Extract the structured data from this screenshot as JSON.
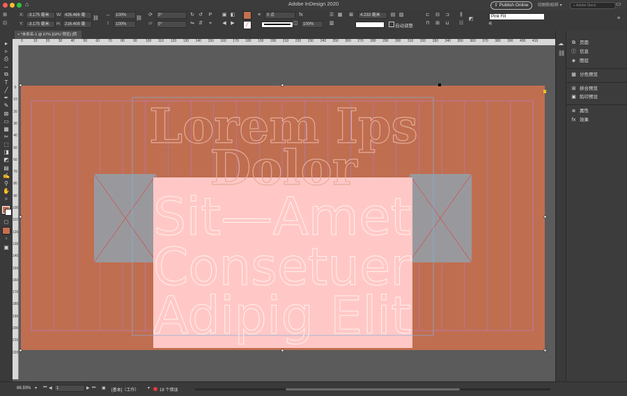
{
  "app": {
    "title": "Adobe InDesign 2020",
    "publish_label": "Publish Online",
    "workspace_label": "印刷和校样",
    "search_placeholder": "Adobe Stock"
  },
  "control": {
    "x_label": "X:",
    "x_value": "-3.175 毫米",
    "y_label": "Y:",
    "y_value": "-3.175 毫米",
    "w_label": "W:",
    "w_value": "426.466 毫",
    "h_label": "H:",
    "h_value": "216.408 毫",
    "scale_x": "100%",
    "scale_y": "100%",
    "rotate": "0°",
    "shear": "0°",
    "stroke_weight": "0 点",
    "opacity": "100%",
    "gap_value": "4.233 毫米",
    "auto_fit": "自动调整",
    "style_value": "Pink Fill",
    "fill_color": "#c5714f"
  },
  "tab": {
    "label": "*未命名-1 @ 67% [GPU 预览] [转换]"
  },
  "ruler": {
    "h": [
      "0",
      "10",
      "20",
      "30",
      "40",
      "50",
      "60",
      "70",
      "80",
      "90",
      "100",
      "110",
      "120",
      "130",
      "140",
      "150",
      "160",
      "170",
      "180",
      "190",
      "200",
      "210",
      "220",
      "230",
      "240",
      "250",
      "260",
      "270",
      "280",
      "290",
      "300",
      "310",
      "320",
      "330",
      "340",
      "350",
      "360",
      "370",
      "380",
      "390",
      "400",
      "410"
    ],
    "v": [
      "0",
      "10",
      "20",
      "30",
      "40",
      "50",
      "60",
      "70",
      "80",
      "90",
      "100",
      "110",
      "120",
      "130",
      "140",
      "150",
      "160",
      "170",
      "180",
      "190",
      "200",
      "210",
      "220"
    ]
  },
  "canvas": {
    "page_color": "#c06e50",
    "block_color": "#99999d",
    "pink_color": "#ffc8c6",
    "lines": [
      "Lorem Ips",
      "Dolor",
      "Sit—Amet",
      "Consetuer",
      "Adipig Elit"
    ]
  },
  "panels": {
    "items": [
      "页面",
      "信息",
      "图层",
      "分色预览",
      "拼合预览",
      "陷印预设",
      "属性",
      "效果"
    ]
  },
  "status": {
    "zoom": "86.93%",
    "page": "1",
    "master_status": "[基本]（工作）",
    "error_text": "18 个错误"
  }
}
